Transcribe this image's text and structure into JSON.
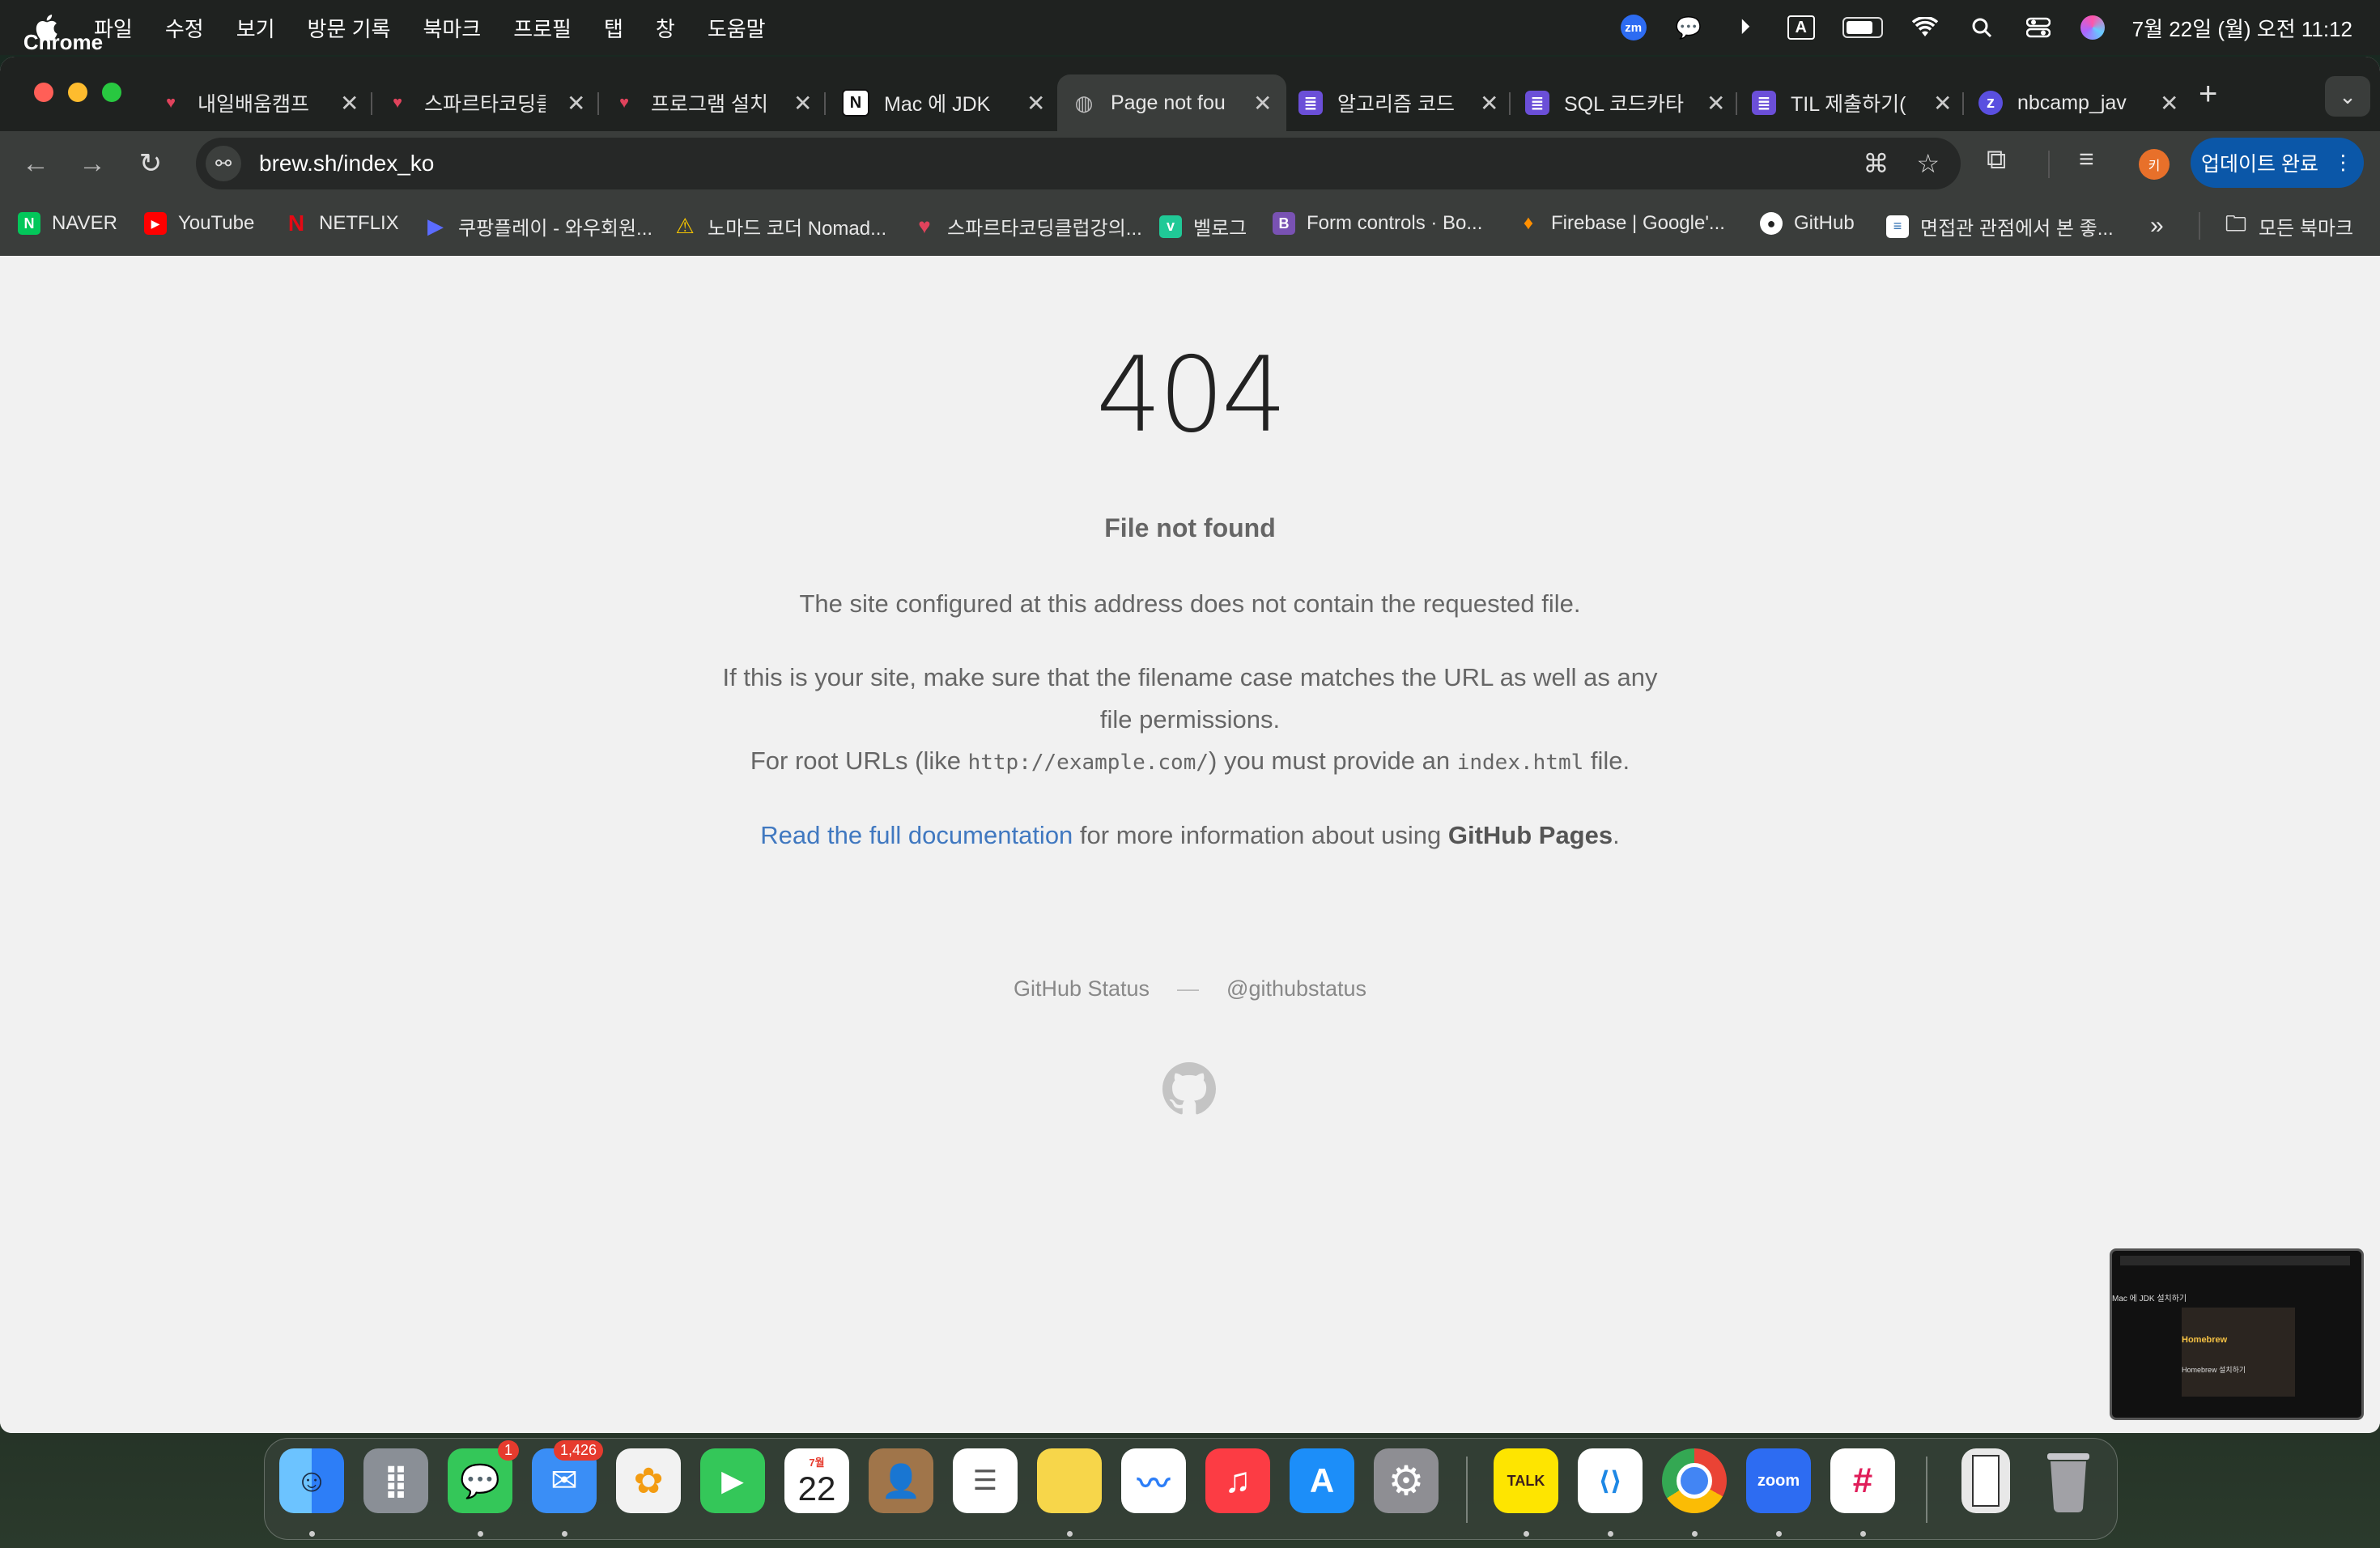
{
  "menubar": {
    "app_name": "Chrome",
    "menus": [
      "파일",
      "수정",
      "보기",
      "방문 기록",
      "북마크",
      "프로필",
      "탭",
      "창",
      "도움말"
    ],
    "datetime": "7월 22일 (월) 오전 11:12",
    "input_indicator": "A",
    "zoom_badge": "zm"
  },
  "tabs": [
    {
      "title": "내일배움캠프",
      "icon": "heart-icon",
      "color": "#e0435c"
    },
    {
      "title": "스파르타코딩클",
      "icon": "heart-icon",
      "color": "#e0435c"
    },
    {
      "title": "프로그램 설치",
      "icon": "heart-icon",
      "color": "#e0435c"
    },
    {
      "title": "Mac 에 JDK",
      "icon": "notion-icon",
      "color": "#ffffff"
    },
    {
      "title": "Page not fou",
      "icon": "globe-icon",
      "color": "#bbbbbb",
      "active": true
    },
    {
      "title": "알고리즘 코드",
      "icon": "list-icon",
      "color": "#6b4fd8"
    },
    {
      "title": "SQL 코드카타",
      "icon": "list-icon",
      "color": "#6b4fd8"
    },
    {
      "title": "TIL 제출하기(",
      "icon": "list-icon",
      "color": "#6b4fd8"
    },
    {
      "title": "nbcamp_jav",
      "icon": "z-icon",
      "color": "#5a4fe0"
    }
  ],
  "omnibox": {
    "url": "brew.sh/index_ko"
  },
  "toolbar": {
    "profile_initial": "키",
    "update_label": "업데이트 완료"
  },
  "bookmarks": [
    {
      "label": "NAVER",
      "icon": "N",
      "color": "#03c75a"
    },
    {
      "label": "YouTube",
      "icon": "▶",
      "color": "#ff0000"
    },
    {
      "label": "NETFLIX",
      "icon": "N",
      "color": "#e50914"
    },
    {
      "label": "쿠팡플레이 - 와우회원...",
      "icon": "▶",
      "color": "#5b6cff"
    },
    {
      "label": "노마드 코더 Nomad...",
      "icon": "⚠",
      "color": "#f4c400"
    },
    {
      "label": "스파르타코딩클럽강의...",
      "icon": "♥",
      "color": "#e0435c"
    },
    {
      "label": "벨로그",
      "icon": "v",
      "color": "#20c997"
    },
    {
      "label": "Form controls · Bo...",
      "icon": "B",
      "color": "#7952b3"
    },
    {
      "label": "Firebase | Google'...",
      "icon": "🔥",
      "color": "#ff8f00"
    },
    {
      "label": "GitHub",
      "icon": "●",
      "color": "#222222"
    },
    {
      "label": "면접관 관점에서 본 좋...",
      "icon": "≡",
      "color": "#2b6cb0"
    }
  ],
  "bookmarks_more": "»",
  "all_bookmarks": "모든 북마크",
  "page": {
    "code": "404",
    "title": "File not found",
    "line1": "The site configured at this address does not contain the requested file.",
    "line2a": "If this is your site, make sure that the filename case matches the URL as well as any",
    "line2b": "file permissions.",
    "line3_pre": "For root URLs (like ",
    "line3_code1": "http://example.com/",
    "line3_mid": ") you must provide an ",
    "line3_code2": "index.html",
    "line3_post": " file.",
    "doc_link": "Read the full documentation",
    "doc_mid": " for more information about using ",
    "doc_bold": "GitHub Pages",
    "doc_end": ".",
    "status_link": "GitHub Status",
    "dash": "—",
    "twitter_link": "@githubstatus"
  },
  "pip": {
    "title": "Mac 에 JDK 설치하기",
    "brand": "Homebrew",
    "subtitle": "Homebrew 설치하기"
  },
  "dock": [
    {
      "name": "finder",
      "label": "",
      "color": "#3d8ef2"
    },
    {
      "name": "launchpad",
      "label": "",
      "color": "#8a8f96"
    },
    {
      "name": "messages",
      "label": "",
      "color": "#34c759",
      "badge": "1"
    },
    {
      "name": "mail",
      "label": "",
      "color": "#3a8ef6",
      "badge": "1,426"
    },
    {
      "name": "photos",
      "label": "",
      "color": "#f2f2f2"
    },
    {
      "name": "facetime",
      "label": "",
      "color": "#34c759"
    },
    {
      "name": "calendar",
      "label": "22",
      "month": "7월",
      "color": "#ffffff"
    },
    {
      "name": "contacts",
      "label": "",
      "color": "#a0754a"
    },
    {
      "name": "reminders",
      "label": "",
      "color": "#ffffff"
    },
    {
      "name": "notes",
      "label": "",
      "color": "#f7d64a"
    },
    {
      "name": "freeform",
      "label": "",
      "color": "#ffffff"
    },
    {
      "name": "music",
      "label": "♫",
      "color": "#fc3c44"
    },
    {
      "name": "app-store",
      "label": "A",
      "color": "#1c8ef9"
    },
    {
      "name": "system-settings",
      "label": "⚙",
      "color": "#8e8e93"
    },
    {
      "name": "kakaotalk",
      "label": "TALK",
      "color": "#fee500"
    },
    {
      "name": "vscode",
      "label": "⟨⟩",
      "color": "#1e88e5"
    },
    {
      "name": "chrome",
      "label": "",
      "color": "#ffffff"
    },
    {
      "name": "zoom",
      "label": "zoom",
      "color": "#2d6cf2"
    },
    {
      "name": "slack",
      "label": "#",
      "color": "#ffffff"
    },
    {
      "name": "document-stack",
      "label": "",
      "color": "#e8e8e8"
    },
    {
      "name": "trash",
      "label": "",
      "color": "#8e8e93"
    }
  ]
}
